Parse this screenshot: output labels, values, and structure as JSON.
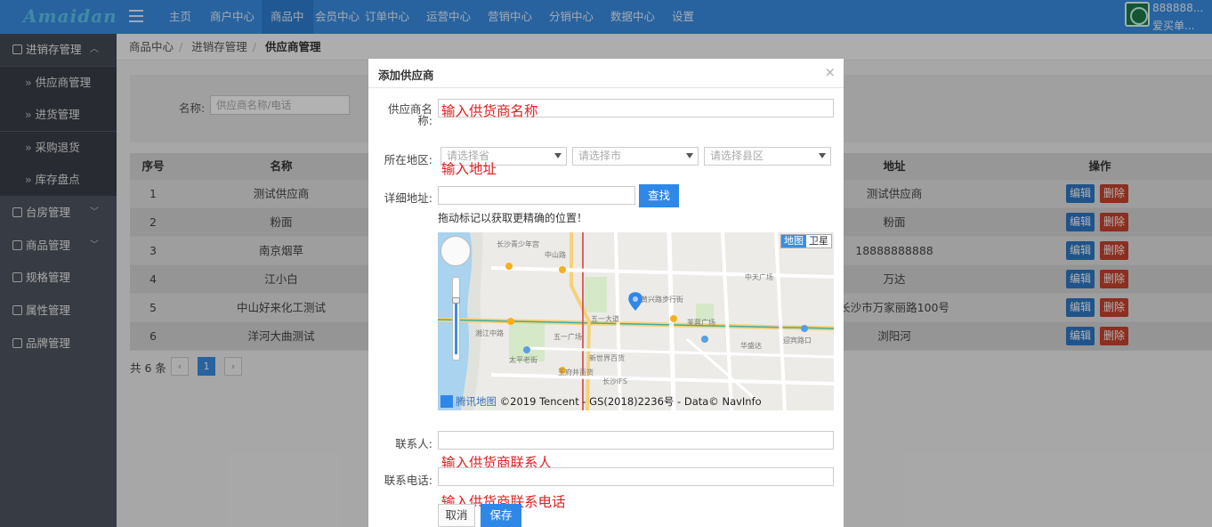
{
  "app": {
    "logo": "Amaidan"
  },
  "topnav": [
    "主页",
    "商户中心",
    "商品中心",
    "会员中心",
    "订单中心",
    "运营中心",
    "营销中心",
    "分销中心",
    "数据中心",
    "设置"
  ],
  "topnav_active": 2,
  "user": {
    "line1": "888888...",
    "line2": "爱买单..."
  },
  "sidebar": {
    "group1": "进销存管理",
    "subitems": [
      "供应商管理",
      "进货管理",
      "采购退货",
      "库存盘点"
    ],
    "groups": [
      "台房管理",
      "商品管理",
      "规格管理",
      "属性管理",
      "品牌管理"
    ]
  },
  "breadcrumb": [
    "商品中心",
    "进销存管理",
    "供应商管理"
  ],
  "filter": {
    "label": "名称:",
    "placeholder": "供应商名称/电话"
  },
  "table": {
    "headers": {
      "index": "序号",
      "name": "名称",
      "address": "地址",
      "actions": "操作"
    },
    "rows": [
      {
        "index": "1",
        "name": "测试供应商",
        "address": "测试供应商"
      },
      {
        "index": "2",
        "name": "粉面",
        "address": "粉面"
      },
      {
        "index": "3",
        "name": "南京烟草",
        "address": "18888888888"
      },
      {
        "index": "4",
        "name": "江小白",
        "address": "万达"
      },
      {
        "index": "5",
        "name": "中山好来化工测试",
        "address": "长沙市万家丽路100号"
      },
      {
        "index": "6",
        "name": "洋河大曲测试",
        "address": "浏阳河"
      }
    ],
    "edit_label": "编辑",
    "delete_label": "删除"
  },
  "pager": {
    "total": "共 6 条",
    "prev": "‹",
    "current": "1",
    "next": "›"
  },
  "modal": {
    "title": "添加供应商",
    "close": "×",
    "name_label": "供应商名称:",
    "name_hint": "输入供货商名称",
    "region_label": "所在地区:",
    "province_placeholder": "请选择省",
    "city_placeholder": "请选择市",
    "district_placeholder": "请选择县区",
    "region_hint": "输入地址",
    "address_label": "详细地址:",
    "find_label": "查找",
    "drag_tip": "拖动标记以获取更精确的位置！",
    "map_type_map": "地图",
    "map_type_satellite": "卫星",
    "map_brand": "腾讯地图",
    "map_copyright": "©2019 Tencent - GS(2018)2236号 - Data© NavInfo",
    "contact_label": "联系人:",
    "contact_hint": "输入供货商联系人",
    "phone_label": "联系电话:",
    "phone_hint": "输入供货商联系电话",
    "cancel_label": "取消",
    "save_label": "保存"
  },
  "map_labels": [
    "长沙青少年宫",
    "中山路",
    "五一广场",
    "五一大道",
    "中天广场",
    "芙蓉广场",
    "湘江中路",
    "太平老街",
    "新世界百货",
    "黄兴路步行街",
    "长沙IFS",
    "华盛达",
    "迎宾路口",
    "王府井百货"
  ],
  "colors": {
    "topbar": "#3a8ee6",
    "sidebar": "#4f5561",
    "primary": "#2f88e8",
    "hint": "#e02020",
    "edit": "#2d79c7",
    "delete": "#c9432e"
  }
}
